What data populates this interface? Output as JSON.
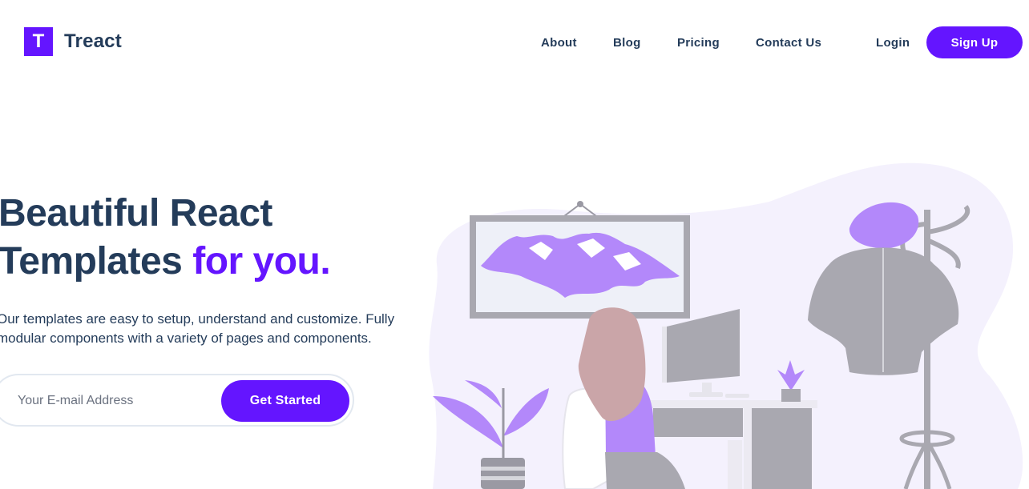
{
  "brand": {
    "logo_letter": "T",
    "name": "Treact",
    "accent": "#6415ff",
    "text_color": "#243c5a"
  },
  "nav": {
    "links": [
      "About",
      "Blog",
      "Pricing",
      "Contact Us"
    ],
    "login": "Login",
    "signup": "Sign Up"
  },
  "hero": {
    "heading_line1": "Beautiful React",
    "heading_line2": "Templates",
    "heading_accent": "for you.",
    "description_line1": "Our templates are easy to setup, understand and customize. Fully",
    "description_line2": "modular components with a variety of pages and components.",
    "email_placeholder": "Your E-mail Address",
    "cta": "Get Started"
  }
}
